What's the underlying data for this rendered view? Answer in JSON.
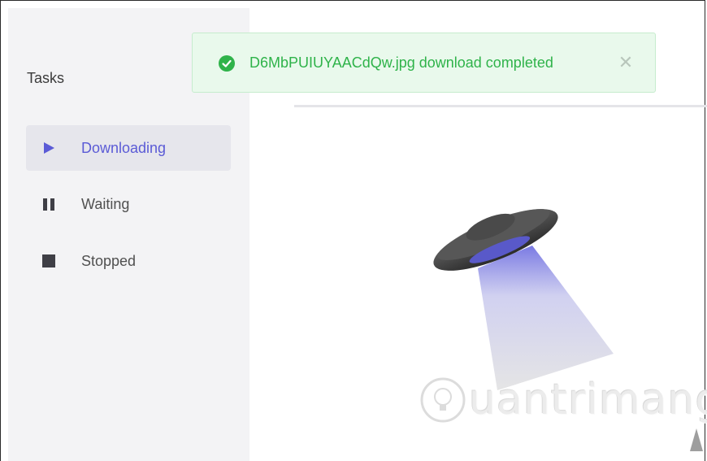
{
  "sidebar": {
    "title": "Tasks",
    "items": [
      {
        "label": "Downloading",
        "icon": "play-icon",
        "active": true
      },
      {
        "label": "Waiting",
        "icon": "pause-icon",
        "active": false
      },
      {
        "label": "Stopped",
        "icon": "stop-icon",
        "active": false
      }
    ]
  },
  "notification": {
    "message": "D6MbPUIUYAACdQw.jpg download completed",
    "icon": "check-circle-icon",
    "close_icon": "close-icon"
  },
  "empty_state": {
    "illustration": "ufo-icon"
  },
  "watermark": {
    "text": "uantrimang",
    "icon": "lightbulb-icon"
  },
  "colors": {
    "accent": "#5b5bd6",
    "success": "#2fb34a",
    "success_bg": "#e9f9ec",
    "sidebar_bg": "#f3f3f5"
  }
}
